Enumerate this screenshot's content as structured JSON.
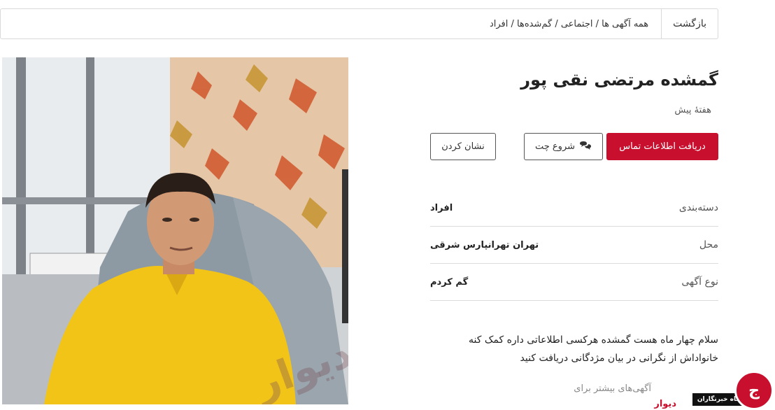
{
  "breadcrumb": {
    "back_label": "بازگشت",
    "path": "همه آگهی ها / اجتماعی / گم‌شده‌ها / افراد"
  },
  "ad": {
    "title": "گمشده مرتضی نقی پور",
    "time_ago": "هفتهٔ پیش",
    "buttons": {
      "contact": "دریافت اطلاعات تماس",
      "chat": "شروع چت",
      "mark": "نشان کردن"
    },
    "details": [
      {
        "key": "دسته‌بندی",
        "value": "افراد"
      },
      {
        "key": "محل",
        "value": "تهران تهرانپارس شرقی"
      },
      {
        "key": "نوع آگهی",
        "value": "گم کردم"
      }
    ],
    "description": "سلام چهار ماه هست گمشده هرکسی اطلاعاتی داره کمک کنه خانواداش از نگرانی در بیان مژدگانی دریافت کنید",
    "more_ads_label": "آگهی‌های بیشتر برای",
    "more_ads_link": "دیوار"
  },
  "photo_watermark": "دیوار",
  "badge": {
    "text": "باشگاه خبرنگاران",
    "logo_letter": "ج"
  },
  "colors": {
    "accent": "#c8102e",
    "border": "#d9d9d9"
  }
}
